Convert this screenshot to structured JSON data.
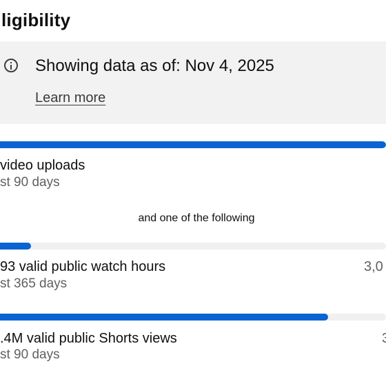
{
  "section": {
    "title": "ligibility"
  },
  "notice": {
    "icon": "info-icon",
    "text": "Showing data as of: Nov 4, 2025",
    "link_label": "Learn more"
  },
  "requirements": {
    "uploads": {
      "progress": 1.0,
      "label": "video uploads",
      "sublabel": "st 90 days"
    },
    "divider": "and one of the following",
    "watch_hours": {
      "progress": 0.08,
      "label": "93 valid public watch hours",
      "sublabel": "st 365 days",
      "target": "3,0"
    },
    "shorts_views": {
      "progress": 0.85,
      "label": ".4M valid public Shorts views",
      "sublabel": "st 90 days",
      "target": "3"
    }
  },
  "colors": {
    "progress_fill": "#0a63d2",
    "progress_track": "#f0f0f0",
    "notice_background": "#f2f2f2"
  }
}
